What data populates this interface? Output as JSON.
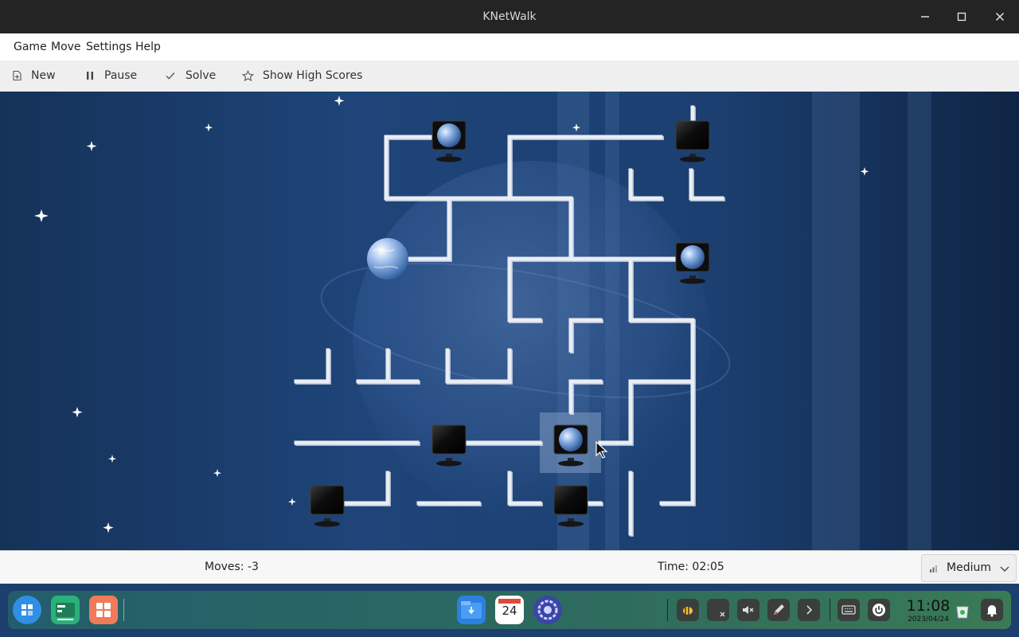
{
  "window": {
    "title": "KNetWalk",
    "minimize_glyph": "—",
    "maximize_glyph": "□",
    "close_glyph": "✕"
  },
  "menu": {
    "items": [
      "Game",
      "Move",
      "Settings",
      "Help"
    ]
  },
  "toolbar": {
    "new_label": "New",
    "pause_label": "Pause",
    "solve_label": "Solve",
    "highscores_label": "Show High Scores"
  },
  "status": {
    "moves": "Moves: -3",
    "time": "Time: 02:05",
    "difficulty": "Medium"
  },
  "taskbar": {
    "launcher_icons": [
      "launcher-icon",
      "terminal-icon",
      "app-grid-icon"
    ],
    "dock_icons": [
      "file-manager-icon",
      "calendar-icon",
      "settings-icon"
    ],
    "calendar_day": "24",
    "tray_icons": [
      "bee-icon",
      "close-app-icon",
      "mute-icon",
      "pen-icon",
      "chevron-right-icon",
      "keyboard-icon",
      "power-icon",
      "trash-icon",
      "bell-icon"
    ],
    "clock_time": "11:08",
    "clock_date": "2023/04/24"
  },
  "colors": {
    "board_background": "#1d3f6d",
    "pipe": "#c9ced6",
    "highlight": "#6f8fb5",
    "titlebar": "#242424"
  }
}
